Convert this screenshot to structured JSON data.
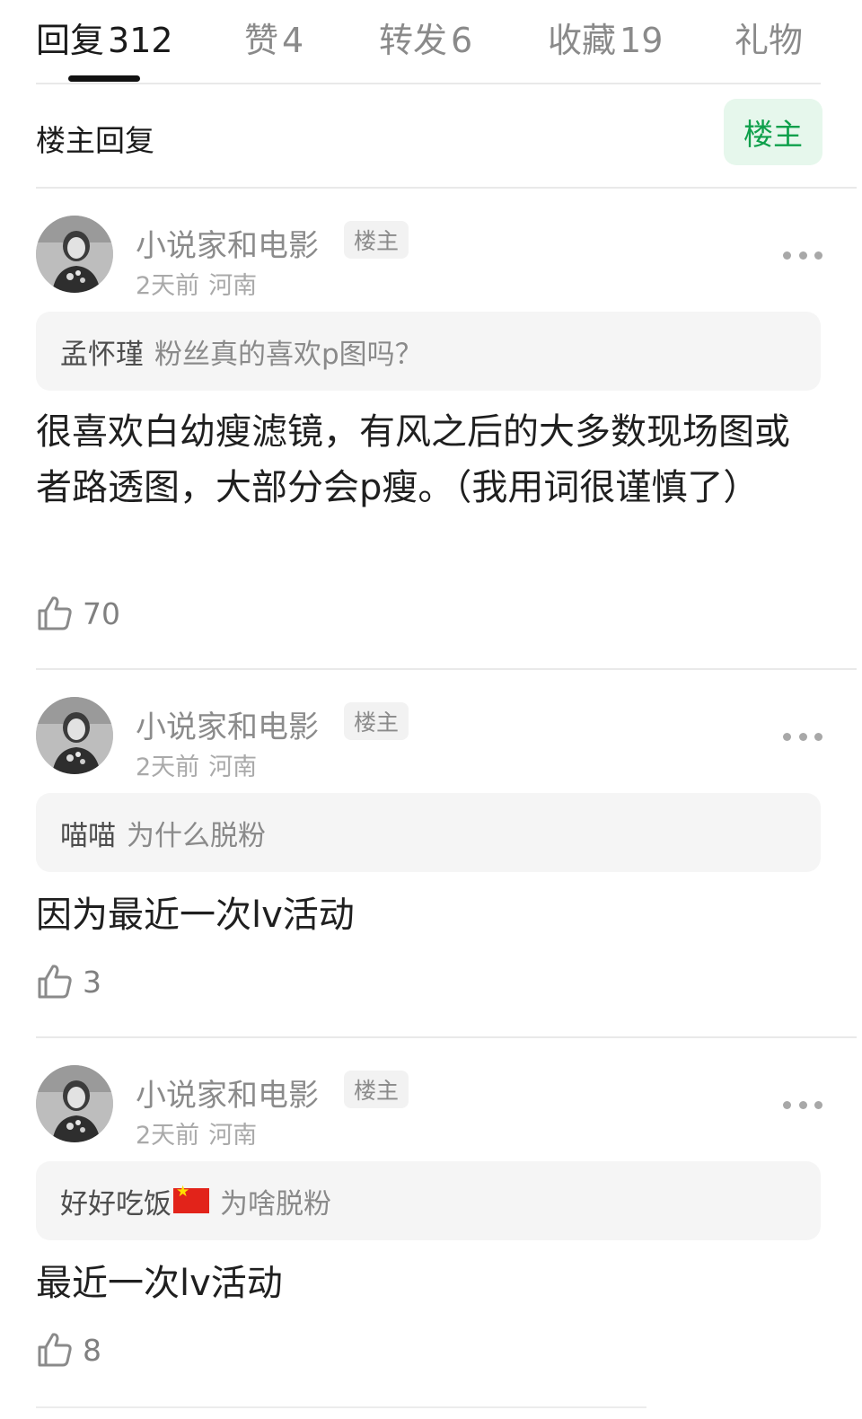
{
  "tabs": [
    {
      "label": "回复",
      "count": "312",
      "active": true
    },
    {
      "label": "赞",
      "count": "4"
    },
    {
      "label": "转发",
      "count": "6"
    },
    {
      "label": "收藏",
      "count": "19"
    },
    {
      "label": "礼物",
      "count": ""
    }
  ],
  "filter": {
    "title": "楼主回复",
    "op_button": "楼主"
  },
  "comments": [
    {
      "username": "小说家和电影",
      "tag": "楼主",
      "time": "2天前",
      "location": "河南",
      "quote_user": "孟怀瑾",
      "quote_text": "粉丝真的喜欢p图吗？",
      "text": "很喜欢白幼瘦滤镜，有风之后的大多数现场图或者路透图，大部分会p瘦。（我用词很谨慎了）",
      "likes": "70"
    },
    {
      "username": "小说家和电影",
      "tag": "楼主",
      "time": "2天前",
      "location": "河南",
      "quote_user": "喵喵",
      "quote_text": "为什么脱粉",
      "text": "因为最近一次lv活动",
      "likes": "3"
    },
    {
      "username": "小说家和电影",
      "tag": "楼主",
      "time": "2天前",
      "location": "河南",
      "quote_user": "好好吃饭",
      "quote_flag": "china-flag-emoji",
      "quote_text": "为啥脱粉",
      "text": "最近一次lv活动",
      "likes": "8"
    }
  ],
  "icons": {
    "like": "thumbs-up-icon",
    "more": "more-dots-icon"
  },
  "colors": {
    "accent_green": "#0ea04b",
    "op_button_bg": "#e6f7ec",
    "muted_text": "#8b8b8b"
  }
}
